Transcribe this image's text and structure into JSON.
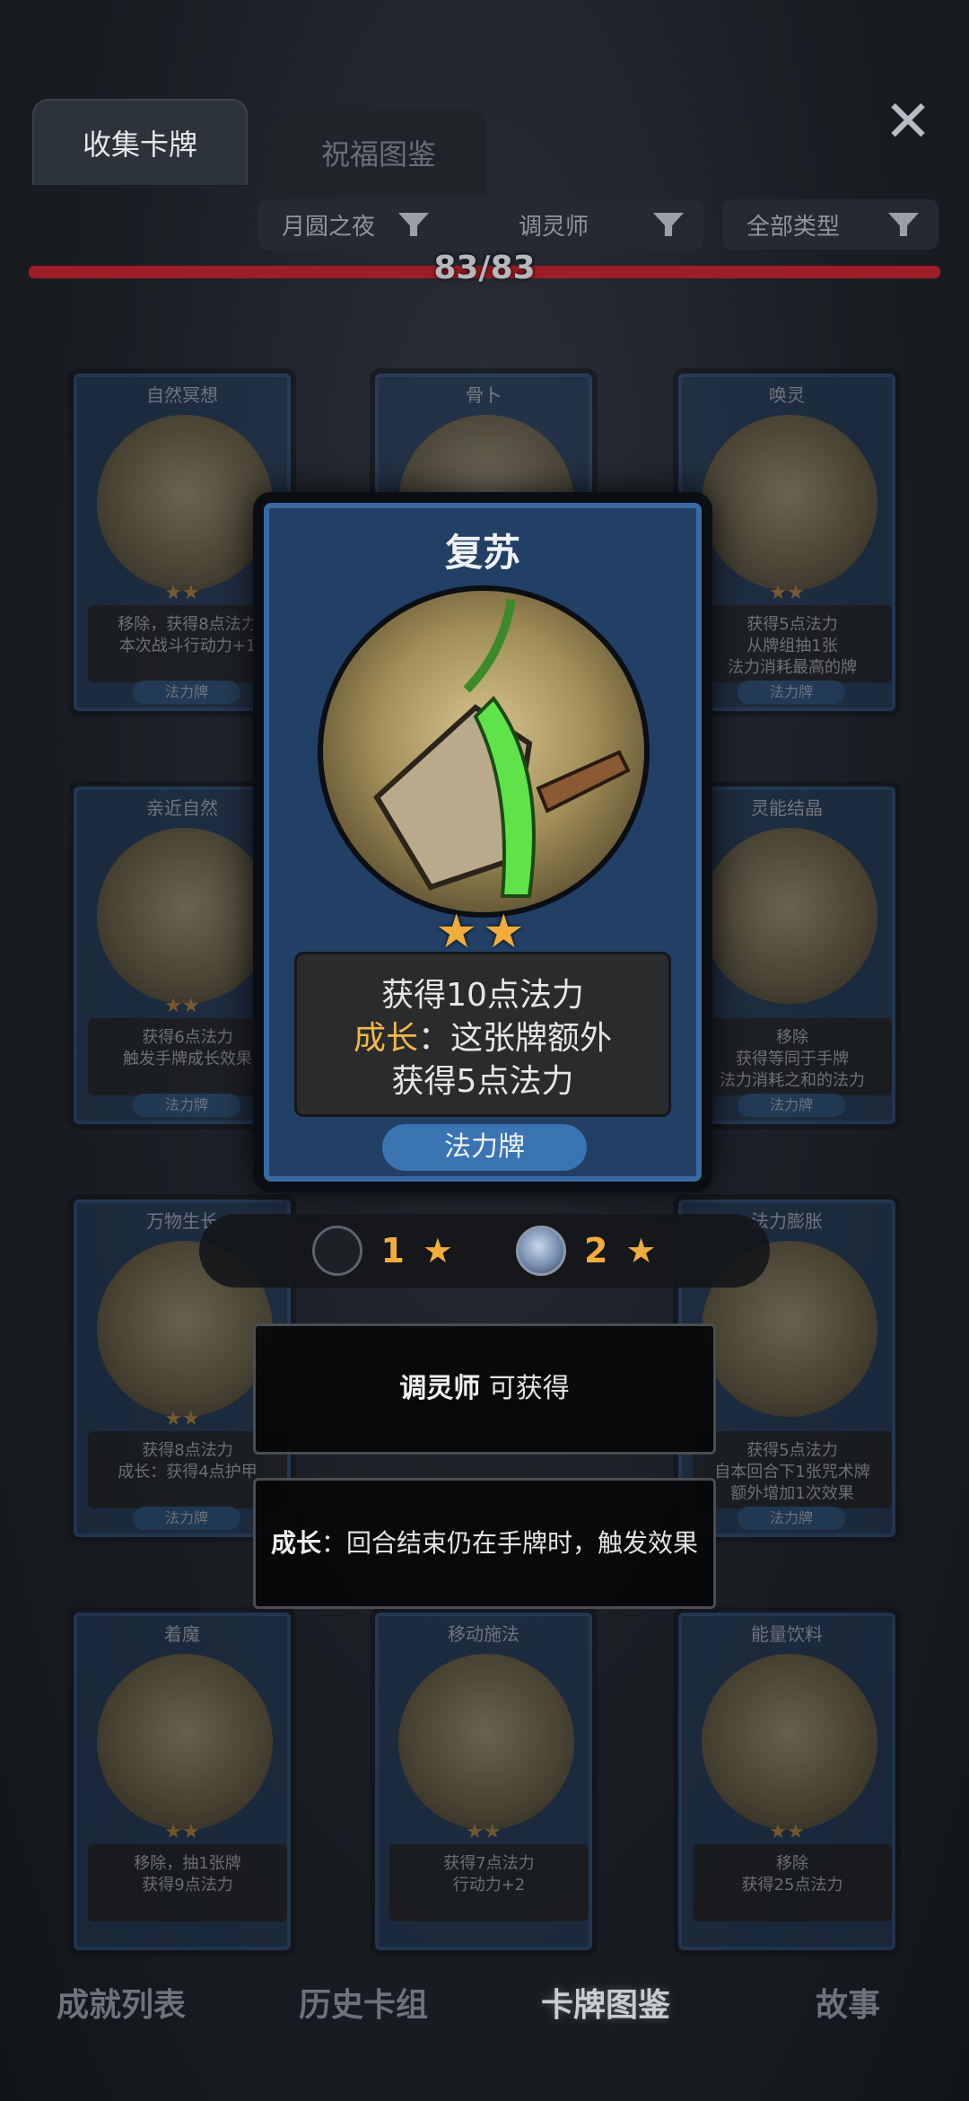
{
  "tabs": [
    {
      "label": "收集卡牌"
    },
    {
      "label": "祝福图鉴"
    }
  ],
  "close_icon": "close-icon",
  "filters": [
    {
      "label": "月圆之夜"
    },
    {
      "label": "调灵师"
    },
    {
      "label": "全部类型"
    }
  ],
  "progress": {
    "text": "83/83",
    "fraction": 1.0
  },
  "grid_cards": [
    {
      "title": "自然冥想",
      "stars": "★★",
      "desc": "移除，获得8点法力\n本次战斗行动力+1",
      "type": "法力牌"
    },
    {
      "title": "骨卜",
      "stars": "",
      "desc": "",
      "type": ""
    },
    {
      "title": "唤灵",
      "stars": "★★",
      "desc": "获得5点法力\n从牌组抽1张\n法力消耗最高的牌",
      "type": "法力牌"
    },
    {
      "title": "亲近自然",
      "stars": "★★",
      "desc": "获得6点法力\n触发手牌成长效果",
      "type": "法力牌"
    },
    {
      "title": "灵能结晶",
      "stars": "",
      "desc": "移除\n获得等同于手牌\n法力消耗之和的法力",
      "type": "法力牌"
    },
    {
      "title": "万物生长",
      "stars": "★★",
      "desc": "获得8点法力\n成长：获得4点护甲",
      "type": "法力牌"
    },
    {
      "title": "法力膨胀",
      "stars": "",
      "desc": "获得5点法力\n自本回合下1张咒术牌\n额外增加1次效果",
      "type": "法力牌"
    },
    {
      "title": "着魔",
      "stars": "★★",
      "desc": "移除，抽1张牌\n获得9点法力",
      "type": ""
    },
    {
      "title": "移动施法",
      "stars": "★★",
      "desc": "获得7点法力\n行动力+2",
      "type": ""
    },
    {
      "title": "能量饮料",
      "stars": "★★",
      "desc": "移除\n获得25点法力",
      "type": ""
    }
  ],
  "focus_card": {
    "title": "复苏",
    "stars": "★★",
    "line1": "获得10点法力",
    "growth_kw": "成长",
    "line2_rest": "：这张牌额外",
    "line3": "获得5点法力",
    "type": "法力牌"
  },
  "levels": [
    {
      "num": "1",
      "star": "★"
    },
    {
      "num": "2",
      "star": "★"
    }
  ],
  "obtain_box": {
    "class_name": "调灵师",
    "text": "可获得"
  },
  "keyword_box": {
    "kw": "成长",
    "text": "：回合结束仍在手牌时，触发效果"
  },
  "bottom_nav": [
    {
      "label": "成就列表"
    },
    {
      "label": "历史卡组"
    },
    {
      "label": "卡牌图鉴"
    },
    {
      "label": "故事"
    }
  ]
}
